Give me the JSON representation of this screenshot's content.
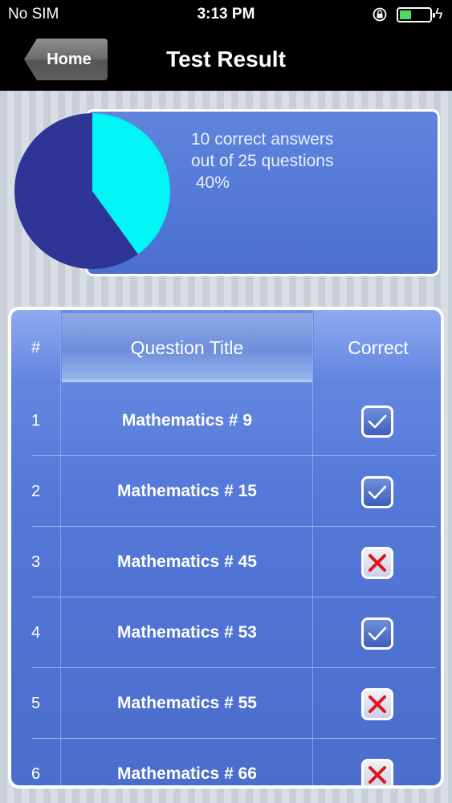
{
  "status_bar": {
    "carrier": "No SIM",
    "time": "3:13 PM",
    "icons": [
      "orientation-lock-icon",
      "battery-icon",
      "charging-bolt-icon"
    ]
  },
  "nav": {
    "back_label": "Home",
    "title": "Test Result"
  },
  "summary": {
    "line1": "10 correct answers",
    "line2": "out of 25 questions",
    "line3": " 40%",
    "correct_fraction": 0.4,
    "colors": {
      "correct": "#00f6f6",
      "incorrect": "#2f3596"
    }
  },
  "table": {
    "headers": {
      "number": "#",
      "title": "Question Title",
      "correct": "Correct"
    },
    "rows": [
      {
        "num": "1",
        "title": "Mathematics # 9",
        "correct": true
      },
      {
        "num": "2",
        "title": "Mathematics # 15",
        "correct": true
      },
      {
        "num": "3",
        "title": "Mathematics # 45",
        "correct": false
      },
      {
        "num": "4",
        "title": "Mathematics # 53",
        "correct": true
      },
      {
        "num": "5",
        "title": "Mathematics # 55",
        "correct": false
      },
      {
        "num": "6",
        "title": "Mathematics # 66",
        "correct": false
      }
    ]
  }
}
